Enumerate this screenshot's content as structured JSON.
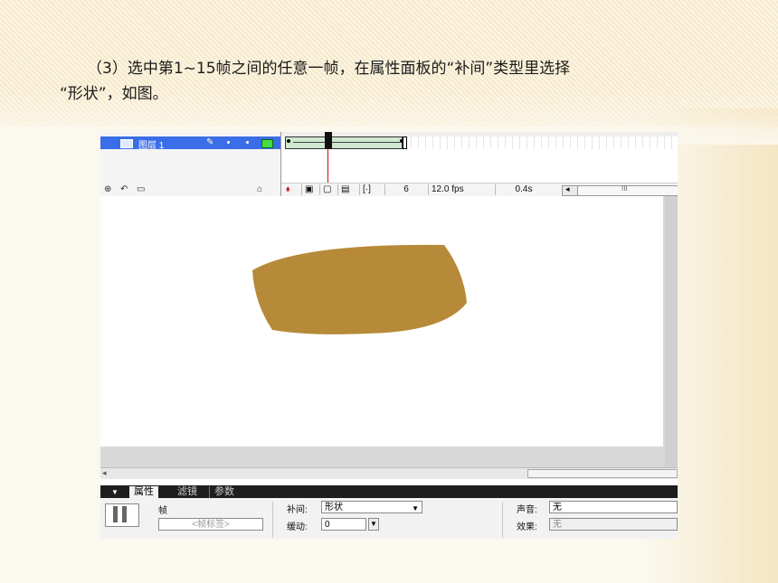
{
  "slide": {
    "caption_line1": "（3）选中第1~15帧之间的任意一帧，在属性面板的“补间”类型里选择",
    "caption_line2": "“形状”，如图。"
  },
  "timeline": {
    "layer_name": "图层 1",
    "current_frame": "6",
    "frame_rate": "12.0 fps",
    "elapsed_time": "0.4s",
    "scrollbar_marker": "III"
  },
  "stage": {
    "shape_color": "#b78a39"
  },
  "properties": {
    "tabs": [
      "属性",
      "滤镜",
      "参数"
    ],
    "active_tab": "属性",
    "section_label": "帧",
    "frame_label_placeholder": "<帧标签>",
    "tween_label": "补间:",
    "tween_value": "形状",
    "ease_label": "缓动:",
    "ease_value": "0",
    "sound_label": "声音:",
    "sound_value": "无",
    "effect_label": "效果:",
    "effect_value": "无"
  }
}
